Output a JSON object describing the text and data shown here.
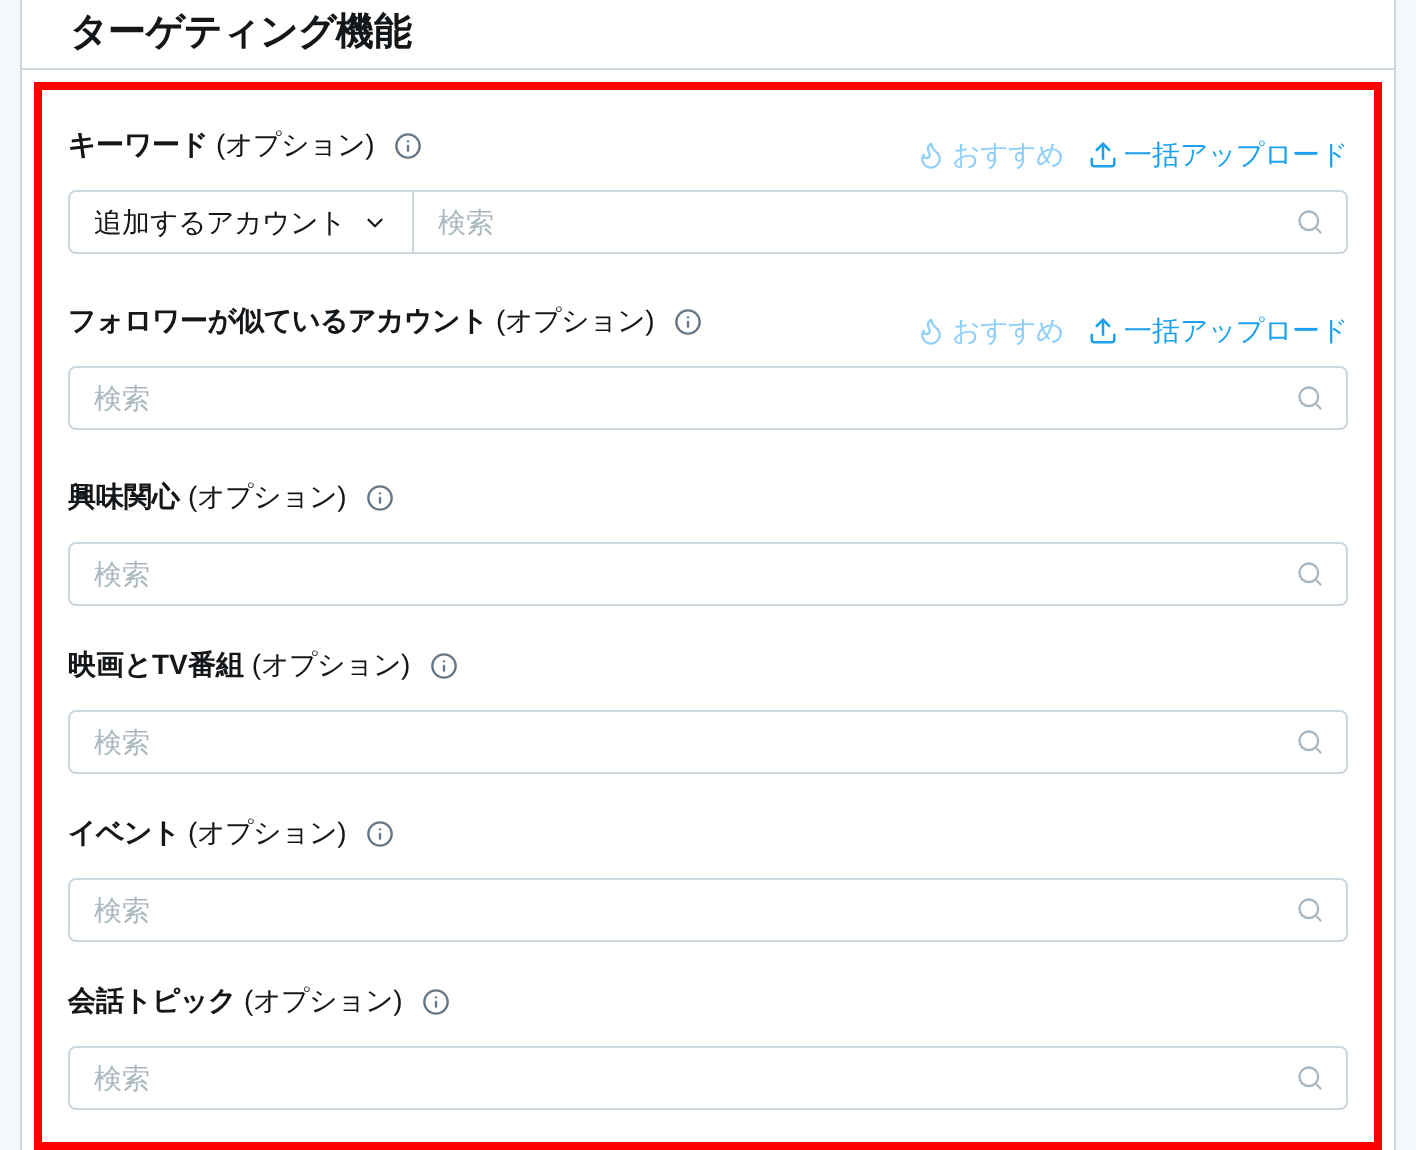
{
  "title": "ターゲティング機能",
  "sections": [
    {
      "name": "キーワード",
      "note": "(オプション)",
      "actions": [
        {
          "kind": "recommend",
          "label": "おすすめ",
          "disabled": true
        },
        {
          "kind": "upload",
          "label": "一括アップロード",
          "disabled": false
        }
      ],
      "dropdown": "追加するアカウント",
      "placeholder": "検索"
    },
    {
      "name": "フォロワーが似ているアカウント",
      "note": "(オプション)",
      "actions": [
        {
          "kind": "recommend",
          "label": "おすすめ",
          "disabled": true
        },
        {
          "kind": "upload",
          "label": "一括アップロード",
          "disabled": false
        }
      ],
      "placeholder": "検索"
    },
    {
      "name": "興味関心",
      "note": "(オプション)",
      "placeholder": "検索"
    },
    {
      "name": "映画とTV番組",
      "note": "(オプション)",
      "placeholder": "検索"
    },
    {
      "name": "イベント",
      "note": "(オプション)",
      "placeholder": "検索"
    },
    {
      "name": "会話トピック",
      "note": "(オプション)",
      "placeholder": "検索"
    }
  ]
}
